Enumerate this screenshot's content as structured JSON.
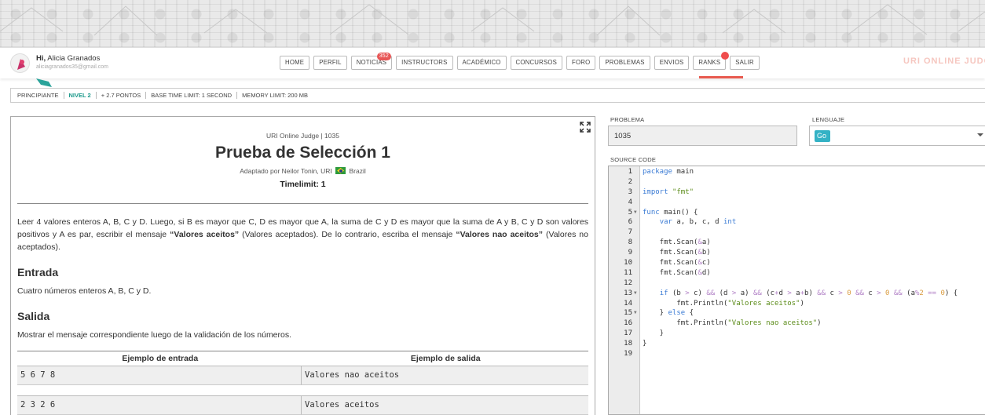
{
  "header": {
    "greeting_prefix": "Hi,",
    "user_name": "Alicia Granados",
    "email": "aliciagranados35@gmail.com",
    "brand_text": "URI ONLINE JUDGE",
    "nav": [
      {
        "label": "HOME"
      },
      {
        "label": "PERFIL"
      },
      {
        "label": "NOTICIAS",
        "badge": "352"
      },
      {
        "label": "INSTRUCTORS"
      },
      {
        "label": "ACADÉMICO"
      },
      {
        "label": "CONCURSOS"
      },
      {
        "label": "FORO"
      },
      {
        "label": "PROBLEMAS"
      },
      {
        "label": "ENVIOS"
      },
      {
        "label": "RANKS"
      },
      {
        "label": "SALIR"
      }
    ]
  },
  "infobar": {
    "category": "PRINCIPIANTE",
    "level": "NIVEL 2",
    "points": "+ 2.7 PONTOS",
    "time_limit": "BASE TIME LIMIT: 1 SECOND",
    "memory_limit": "MEMORY LIMIT: 200 MB"
  },
  "problem": {
    "source": "URI Online Judge | 1035",
    "title": "Prueba de Selección 1",
    "adapted_prefix": "Adaptado por Neilor Tonin, URI",
    "country": "Brazil",
    "timelimit": "Timelimit: 1",
    "description_1": "Leer 4 valores enteros A, B, C y D. Luego, si B es mayor que C, D es mayor que A, la suma de C y D es mayor que la suma de A y B, C y D son valores positivos y A es par, escribir el mensaje ",
    "description_bold_1": "“Valores aceitos”",
    "description_2": " (Valores aceptados). De lo contrario, escriba el mensaje ",
    "description_bold_2": "“Valores nao aceitos”",
    "description_3": " (Valores no aceptados).",
    "input_heading": "Entrada",
    "input_text": "Cuatro números enteros A, B, C y D.",
    "output_heading": "Salida",
    "output_text": "Mostrar el mensaje correspondiente luego de la validación de los números.",
    "examples_header_in": "Ejemplo de entrada",
    "examples_header_out": "Ejemplo de salida",
    "examples": [
      {
        "input": "5 6 7 8",
        "output": "Valores nao aceitos"
      },
      {
        "input": "2 3 2 6",
        "output": "Valores aceitos"
      }
    ]
  },
  "submit": {
    "problem_label": "PROBLEMA",
    "problem_value": "1035",
    "language_label": "LENGUAJE",
    "language_value": "Go",
    "source_label": "SOURCE CODE"
  },
  "code_lines": [
    "package main",
    "",
    "import \"fmt\"",
    "",
    "func main() {",
    "    var a, b, c, d int",
    "",
    "    fmt.Scan(&a)",
    "    fmt.Scan(&b)",
    "    fmt.Scan(&c)",
    "    fmt.Scan(&d)",
    "",
    "    if (b > c) && (d > a) && (c+d > a+b) && c > 0 && c > 0 && (a%2 == 0) {",
    "        fmt.Println(\"Valores aceitos\")",
    "    } else {",
    "        fmt.Println(\"Valores nao aceitos\")",
    "    }",
    "}",
    ""
  ],
  "colors": {
    "accent": "#1b998b",
    "badge": "#e85656",
    "go": "#34b2c5"
  }
}
